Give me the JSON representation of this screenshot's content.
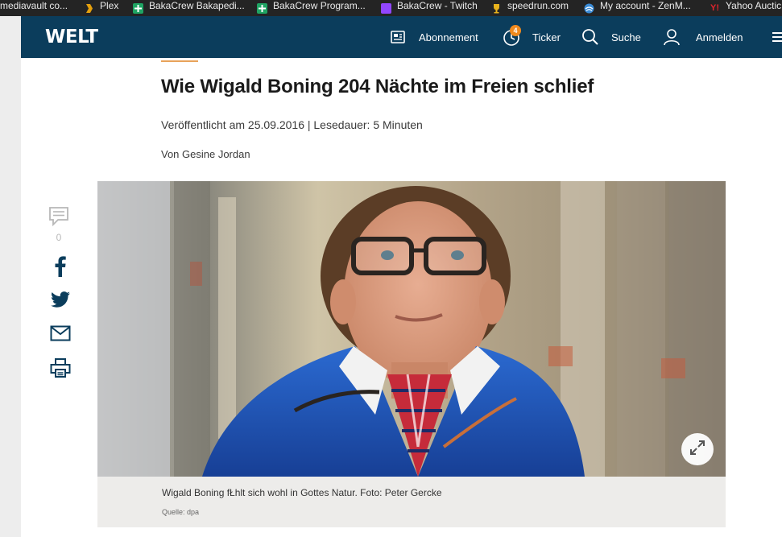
{
  "bookmarks": [
    {
      "label": "mediavault co...",
      "icon": "mediavault-icon",
      "color": "#242424"
    },
    {
      "label": "Plex",
      "icon": "plex-icon",
      "color": "#e5a00d"
    },
    {
      "label": "BakaCrew Bakapedi...",
      "icon": "green-plus-icon",
      "color": "#1fa463"
    },
    {
      "label": "BakaCrew Program...",
      "icon": "green-plus-icon",
      "color": "#1fa463"
    },
    {
      "label": "BakaCrew - Twitch",
      "icon": "twitch-icon",
      "color": "#9146ff"
    },
    {
      "label": "speedrun.com",
      "icon": "trophy-icon",
      "color": "#e8b21c"
    },
    {
      "label": "My account - ZenM...",
      "icon": "zenmate-icon",
      "color": "#3a8bd6"
    },
    {
      "label": "Yahoo Auctic",
      "icon": "yahoo-icon",
      "color": "#e0242d"
    }
  ],
  "header": {
    "logo": "WELT",
    "subscription_label": "Abonnement",
    "ticker_label": "Ticker",
    "ticker_badge": "4",
    "search_label": "Suche",
    "login_label": "Anmelden",
    "background": "#0b3d5c",
    "badge_color": "#f08a1e"
  },
  "article": {
    "title": "Wie Wigald Boning 204 Nächte im Freien schlief",
    "meta": "Veröffentlicht am 25.09.2016 | Lesedauer: 5 Minuten",
    "author": "Von Gesine Jordan",
    "accent_color": "#e8a35a"
  },
  "share": {
    "comment_count": "0"
  },
  "photo": {
    "caption": "Wigald Boning fŁhlt sich wohl in Gottes Natur. Foto: Peter Gercke",
    "source": "Quelle: dpa"
  }
}
